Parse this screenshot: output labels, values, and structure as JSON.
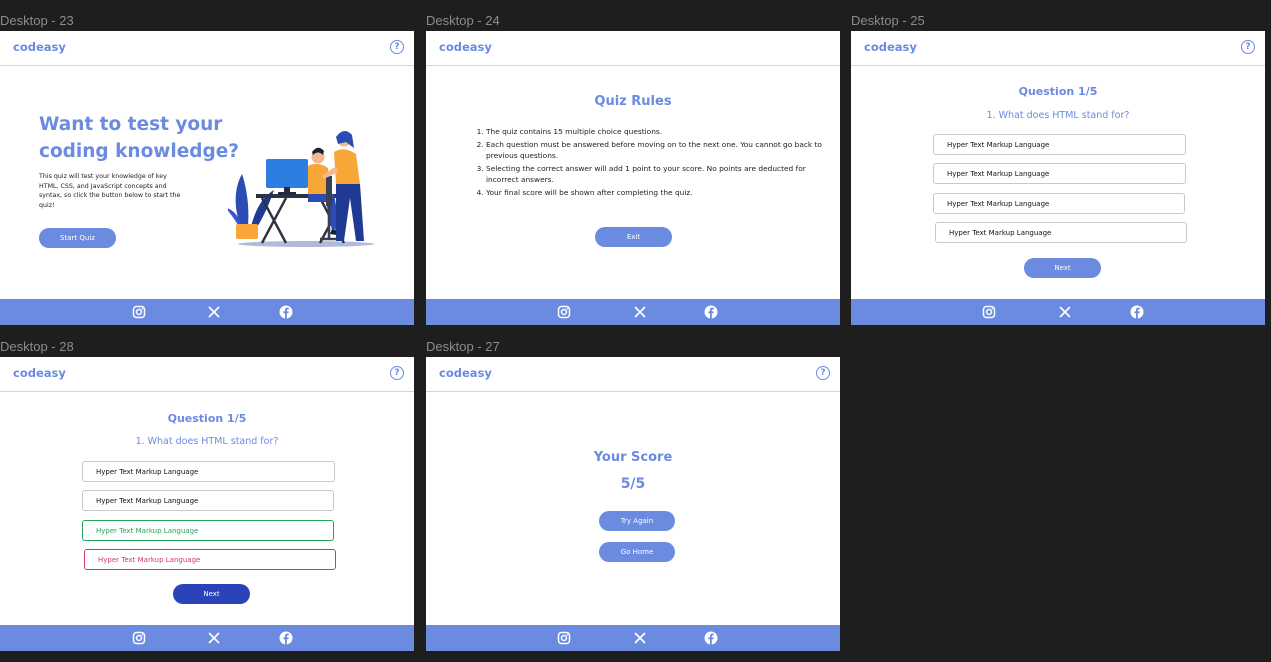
{
  "brand": {
    "logo": "codeasy",
    "help_glyph": "?",
    "accent": "#6a8be0"
  },
  "footer": {
    "icons": [
      "instagram-icon",
      "x-icon",
      "facebook-icon"
    ]
  },
  "frames": {
    "d23": {
      "label": "Desktop - 23",
      "headline_line1": "Want to test your",
      "headline_line2": "coding knowledge?",
      "description": "This quiz will test your knowledge of key HTML, CSS, and JavaScript concepts and syntax, so click the button below to start the quiz!",
      "start_button": "Start Quiz"
    },
    "d24": {
      "label": "Desktop - 24",
      "title": "Quiz Rules",
      "rules": [
        "The quiz contains 15 multiple choice questions.",
        "Each question must be answered before moving on to the next one. You cannot go back to previous questions.",
        "Selecting the correct answer will add 1 point to your score. No points are deducted for incorrect answers.",
        "Your final score will be shown after completing the quiz."
      ],
      "exit_button": "Exit"
    },
    "d25": {
      "label": "Desktop - 25",
      "question_counter": "Question 1/5",
      "question": "1. What does HTML stand for?",
      "options": [
        "Hyper Text Markup Language",
        "Hyper Text Markup Language",
        "Hyper Text Markup Language",
        "Hyper Text Markup Language"
      ],
      "next_button": "Next"
    },
    "d28": {
      "label": "Desktop - 28",
      "question_counter": "Question 1/5",
      "question": "1. What does HTML stand for?",
      "options": [
        "Hyper Text Markup Language",
        "Hyper Text Markup Language",
        "Hyper Text Markup Language",
        "Hyper Text Markup Language"
      ],
      "option_states": [
        "default",
        "default",
        "correct",
        "wrong"
      ],
      "next_button": "Next",
      "next_color": "#2a43b8",
      "correct_color": "#27a55a",
      "wrong_color": "#d23d56"
    },
    "d27": {
      "label": "Desktop - 27",
      "title": "Your Score",
      "score": "5/5",
      "try_again_button": "Try Again",
      "go_home_button": "Go Home"
    }
  }
}
